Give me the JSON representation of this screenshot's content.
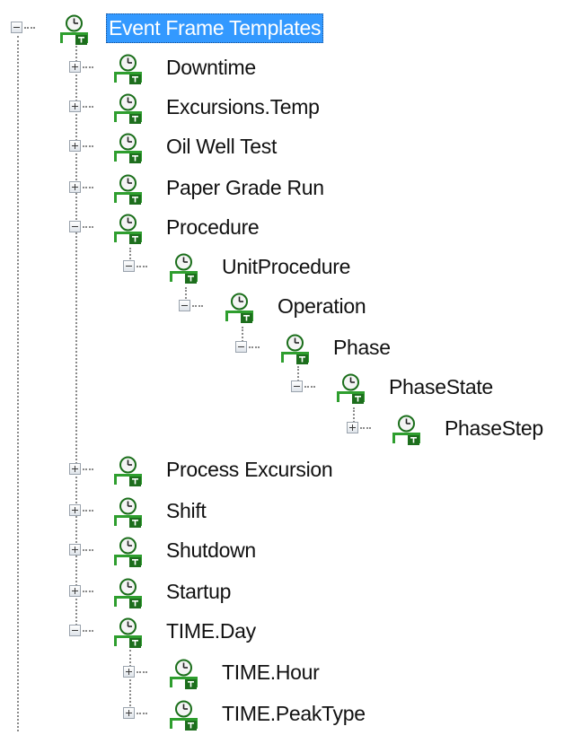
{
  "tree": {
    "root": {
      "label": "Event Frame Templates",
      "expanded": true,
      "selected": true,
      "icon": "event-frame-template-icon"
    },
    "items": [
      {
        "label": "Downtime",
        "expanded": false
      },
      {
        "label": "Excursions.Temp",
        "expanded": false
      },
      {
        "label": "Oil Well Test",
        "expanded": false
      },
      {
        "label": "Paper Grade Run",
        "expanded": false
      },
      {
        "label": "Procedure",
        "expanded": true
      },
      {
        "label": "UnitProcedure",
        "expanded": true
      },
      {
        "label": "Operation",
        "expanded": true
      },
      {
        "label": "Phase",
        "expanded": true
      },
      {
        "label": "PhaseState",
        "expanded": true
      },
      {
        "label": "PhaseStep",
        "expanded": false
      },
      {
        "label": "Process Excursion",
        "expanded": false
      },
      {
        "label": "Shift",
        "expanded": false
      },
      {
        "label": "Shutdown",
        "expanded": false
      },
      {
        "label": "Startup",
        "expanded": false
      },
      {
        "label": "TIME.Day",
        "expanded": true
      },
      {
        "label": "TIME.Hour",
        "expanded": false
      },
      {
        "label": "TIME.PeakType",
        "expanded": false
      }
    ]
  },
  "colors": {
    "selection": "#3399ff",
    "icon_green": "#2e9e2e",
    "icon_dark_green": "#1d6e1d",
    "clock_face": "#f4f4f4",
    "connector": "#8a8a8a"
  }
}
